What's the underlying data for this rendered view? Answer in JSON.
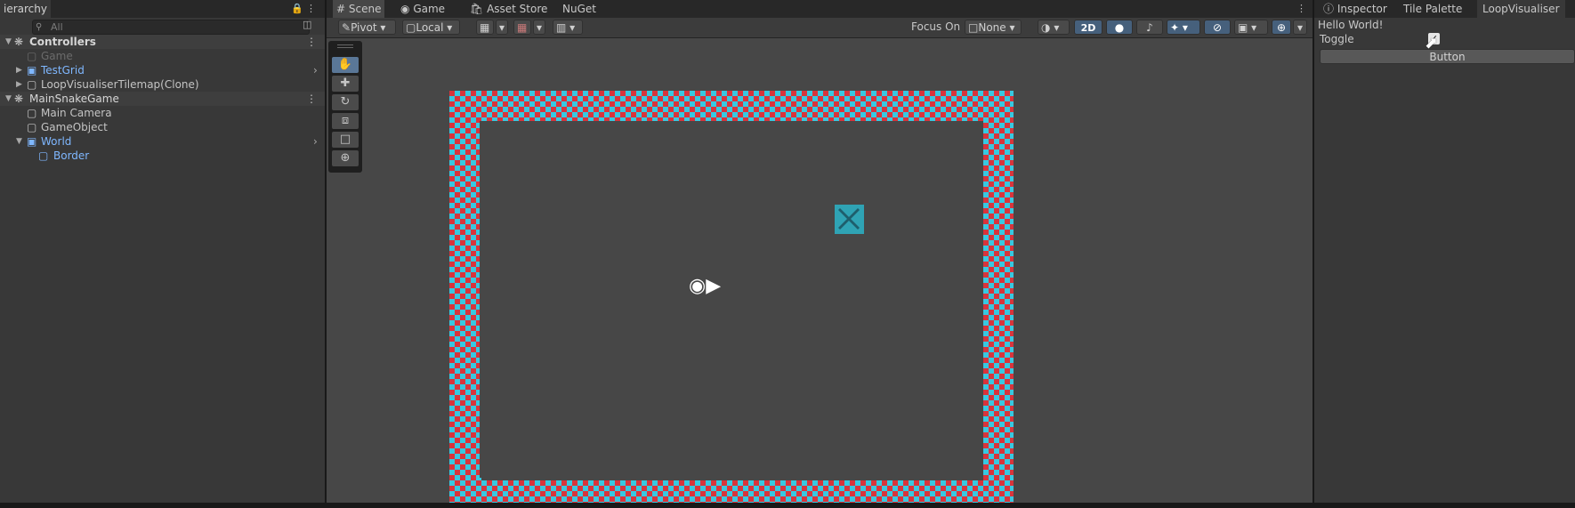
{
  "hierarchy": {
    "tab_label": "ierarchy",
    "search_placeholder": "All",
    "items": [
      {
        "label": "Controllers",
        "kind": "scene"
      },
      {
        "label": "Game",
        "kind": "disabled"
      },
      {
        "label": "TestGrid",
        "kind": "prefab"
      },
      {
        "label": "LoopVisualiserTilemap(Clone)",
        "kind": "object"
      },
      {
        "label": "MainSnakeGame",
        "kind": "scene"
      },
      {
        "label": "Main Camera",
        "kind": "object"
      },
      {
        "label": "GameObject",
        "kind": "object"
      },
      {
        "label": "World",
        "kind": "prefab"
      },
      {
        "label": "Border",
        "kind": "prefab-child"
      }
    ]
  },
  "scene_tabs": [
    "Scene",
    "Game",
    "Asset Store",
    "NuGet"
  ],
  "toolbar": {
    "pivot": "Pivot",
    "local": "Local",
    "focus_on": "Focus On",
    "none": "None",
    "mode_2d": "2D"
  },
  "inspector": {
    "tabs": [
      "Inspector",
      "Tile Palette",
      "LoopVisualiser"
    ],
    "hello": "Hello World!",
    "toggle_label": "Toggle",
    "toggle_checked": true,
    "button_label": "Button"
  },
  "colors": {
    "border_red": "#d8343c",
    "border_cyan": "#38c8e0",
    "accent_blue": "#7fb7ff",
    "active_tool": "#5a7797"
  },
  "icons": [
    "lock-icon",
    "menu-dots-icon",
    "search-icon",
    "hand-tool-icon",
    "move-tool-icon",
    "rotate-tool-icon",
    "scale-tool-icon",
    "rect-tool-icon",
    "transform-tool-icon",
    "camera-gizmo-icon",
    "info-icon"
  ]
}
